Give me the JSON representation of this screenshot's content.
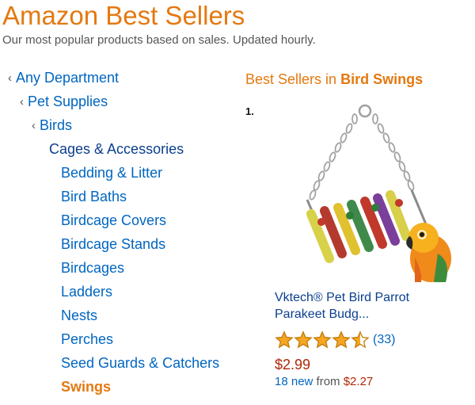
{
  "header": {
    "title": "Amazon Best Sellers",
    "subtitle": "Our most popular products based on sales. Updated hourly."
  },
  "nav": {
    "chevron": "‹",
    "ancestors": [
      {
        "label": "Any Department"
      },
      {
        "label": "Pet Supplies"
      },
      {
        "label": "Birds"
      }
    ],
    "current": "Cages & Accessories",
    "children": [
      {
        "label": "Bedding & Litter"
      },
      {
        "label": "Bird Baths"
      },
      {
        "label": "Birdcage Covers"
      },
      {
        "label": "Birdcage Stands"
      },
      {
        "label": "Birdcages"
      },
      {
        "label": "Ladders"
      },
      {
        "label": "Nests"
      },
      {
        "label": "Perches"
      },
      {
        "label": "Seed Guards & Catchers"
      },
      {
        "label": "Swings",
        "selected": true
      }
    ]
  },
  "main": {
    "heading_prefix": "Best Sellers in",
    "heading_category": "Bird Swings",
    "products": [
      {
        "rank": "1.",
        "image_icon": "bird-swing-with-parrot-image",
        "title": "Vktech® Pet Bird Parrot Parakeet Budg...",
        "rating": 4.5,
        "rating_max": 5,
        "review_count": "(33)",
        "price": "$2.99",
        "offers_link": "18 new",
        "offers_from": "from",
        "offers_price": "$2.27"
      }
    ]
  },
  "colors": {
    "accent_orange": "#e47911",
    "link_blue": "#0066c0",
    "dark_link": "#0b3e8f",
    "price_red": "#b12704",
    "star_gold": "#f5a623"
  }
}
